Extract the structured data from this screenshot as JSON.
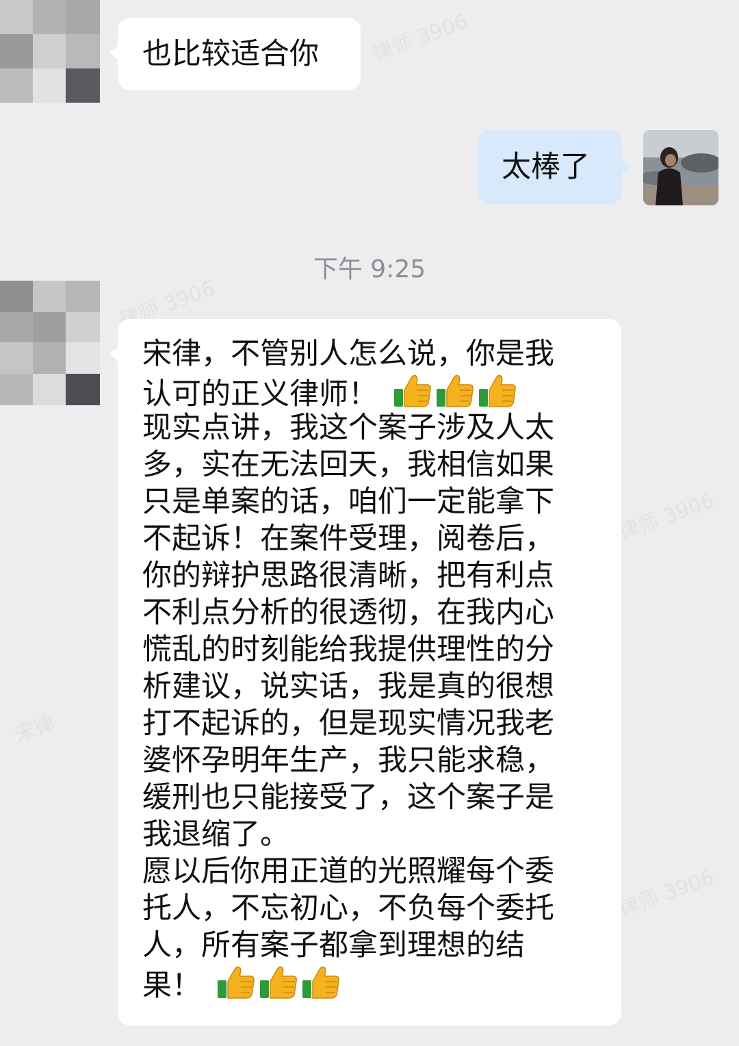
{
  "chat": {
    "messages": [
      {
        "sender": "contact",
        "text": "也比较适合你"
      },
      {
        "sender": "me",
        "text": "太棒了"
      }
    ],
    "timestamp": "下午 9:25",
    "long_message": {
      "lines": [
        "宋律，不管别人怎么说，你是我",
        "认可的正义律师！",
        "现实点讲，我这个案子涉及人太",
        "多，实在无法回天，我相信如果",
        "只是单案的话，咱们一定能拿下",
        "不起诉！在案件受理，阅卷后，",
        "你的辩护思路很清晰，把有利点",
        "不利点分析的很透彻，在我内心",
        "慌乱的时刻能给我提供理性的分",
        "析建议，说实话，我是真的很想",
        "打不起诉的，但是现实情况我老",
        "婆怀孕明年生产，我只能求稳，",
        "缓刑也只能接受了，这个案子是",
        "我退缩了。",
        "愿以后你用正道的光照耀每个委",
        "托人，不忘初心，不负每个委托",
        "人，所有案子都拿到理想的结",
        "果！"
      ],
      "emoji": "thumbs-up-icon",
      "emoji_count": 3
    }
  },
  "colors": {
    "background": "#ededf0",
    "incoming_bubble": "#ffffff",
    "outgoing_bubble": "#d7e9fb",
    "timestamp_text": "#8e8e93"
  }
}
